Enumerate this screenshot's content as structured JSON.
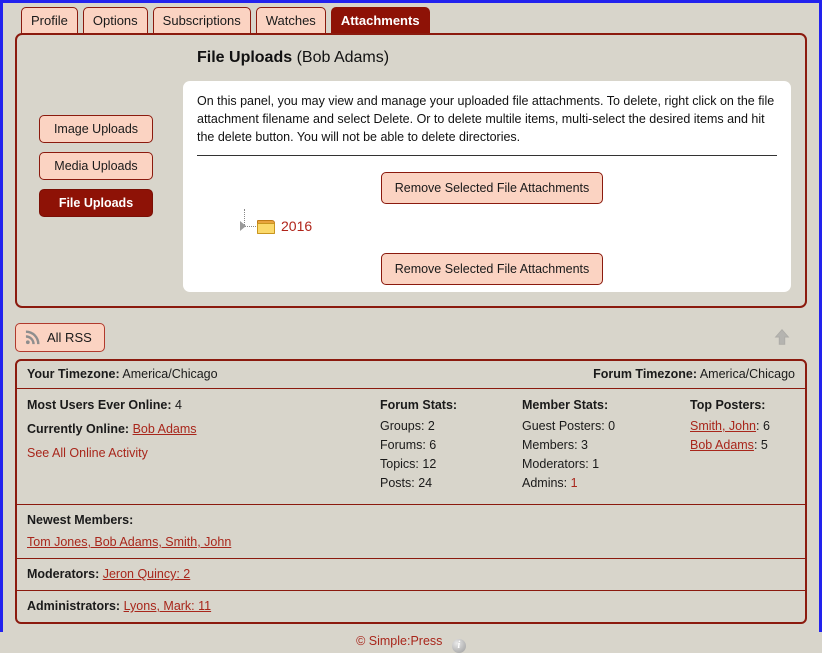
{
  "tabs": [
    {
      "label": "Profile",
      "active": false
    },
    {
      "label": "Options",
      "active": false
    },
    {
      "label": "Subscriptions",
      "active": false
    },
    {
      "label": "Watches",
      "active": false
    },
    {
      "label": "Attachments",
      "active": true
    }
  ],
  "panel": {
    "title": "File Uploads",
    "owner": "(Bob Adams)",
    "description": "On this panel, you may view and manage your uploaded file attachments. To delete, right click on the file attachment filename and select Delete. Or to delete multile items, multi-select the desired items and hit the delete button. You will not be able to delete directories.",
    "remove_button_top": "Remove Selected File Attachments",
    "remove_button_bottom": "Remove Selected File Attachments",
    "tree": {
      "folder_label": "2016",
      "folder_icon": "folder-icon",
      "expander_icon": "expand-arrow-icon"
    }
  },
  "side_buttons": [
    {
      "label": "Image Uploads",
      "active": false
    },
    {
      "label": "Media Uploads",
      "active": false
    },
    {
      "label": "File Uploads",
      "active": true
    }
  ],
  "rss": {
    "label": "All RSS",
    "icon": "rss-icon",
    "back_to_top_icon": "back-to-top-icon"
  },
  "stats": {
    "your_timezone_label": "Your Timezone:",
    "your_timezone_value": "America/Chicago",
    "forum_timezone_label": "Forum Timezone:",
    "forum_timezone_value": "America/Chicago",
    "most_users_label": "Most Users Ever Online:",
    "most_users_value": "4",
    "currently_online_label": "Currently Online:",
    "currently_online_user": "Bob Adams",
    "see_all_activity": "See All Online Activity",
    "forum_stats_header": "Forum Stats:",
    "forum_stats": [
      "Groups: 2",
      "Forums: 6",
      "Topics: 12",
      "Posts: 24"
    ],
    "member_stats_header": "Member Stats:",
    "member_stats": [
      "Guest Posters: 0",
      "Members: 3",
      "Moderators: 1"
    ],
    "admins_label": "Admins:",
    "admins_value": "1",
    "top_posters_header": "Top Posters:",
    "top_posters": [
      {
        "name": "Smith, John",
        "count": "6"
      },
      {
        "name": "Bob Adams",
        "count": "5"
      }
    ],
    "newest_members_header": "Newest Members:",
    "newest_members_value": "Tom Jones, Bob Adams, Smith, John",
    "moderators_label": "Moderators:",
    "moderators_value": "Jeron Quincy: 2",
    "administrators_label": "Administrators:",
    "administrators_value": "Lyons, Mark: 11"
  },
  "footer": {
    "copyright": "© Simple:Press",
    "info_icon": "info-icon",
    "info_glyph": "i"
  },
  "colors": {
    "accent_dark_red": "#8b1a0e",
    "tab_light": "#fbd3c2",
    "tab_active": "#8e1206",
    "page_bg": "#d8d5cb",
    "link_red": "#a8261b",
    "folder_yellow": "#fbd96b"
  }
}
